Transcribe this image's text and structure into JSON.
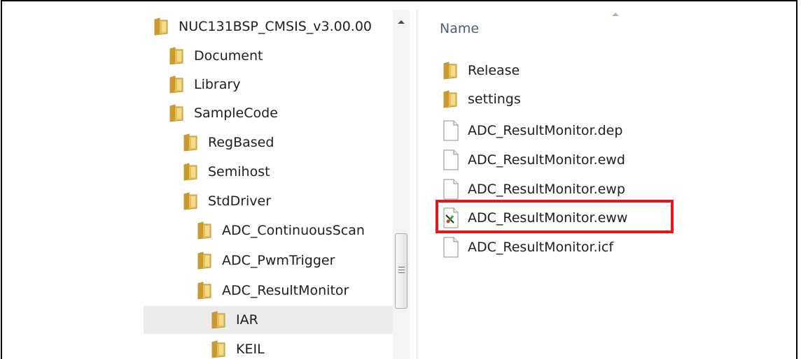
{
  "tree": {
    "items": [
      {
        "label": "NUC131BSP_CMSIS_v3.00.00",
        "name": "tree-item-nuc131bsp"
      },
      {
        "label": "Document",
        "name": "tree-item-document"
      },
      {
        "label": "Library",
        "name": "tree-item-library"
      },
      {
        "label": "SampleCode",
        "name": "tree-item-samplecode"
      },
      {
        "label": "RegBased",
        "name": "tree-item-regbased"
      },
      {
        "label": "Semihost",
        "name": "tree-item-semihost"
      },
      {
        "label": "StdDriver",
        "name": "tree-item-stddriver"
      },
      {
        "label": "ADC_ContinuousScan",
        "name": "tree-item-adc-continuousscan"
      },
      {
        "label": "ADC_PwmTrigger",
        "name": "tree-item-adc-pwmtrigger"
      },
      {
        "label": "ADC_ResultMonitor",
        "name": "tree-item-adc-resultmonitor"
      },
      {
        "label": "IAR",
        "name": "tree-item-iar"
      },
      {
        "label": "KEIL",
        "name": "tree-item-keil"
      }
    ],
    "selected": "IAR"
  },
  "filelist": {
    "column_header": "Name",
    "items": [
      {
        "label": "Release",
        "icon": "folder-icon"
      },
      {
        "label": "settings",
        "icon": "folder-icon"
      },
      {
        "label": "ADC_ResultMonitor.dep",
        "icon": "file-icon"
      },
      {
        "label": "ADC_ResultMonitor.ewd",
        "icon": "file-icon"
      },
      {
        "label": "ADC_ResultMonitor.ewp",
        "icon": "file-icon"
      },
      {
        "label": "ADC_ResultMonitor.eww",
        "icon": "iar-workspace-icon"
      },
      {
        "label": "ADC_ResultMonitor.icf",
        "icon": "file-icon"
      }
    ],
    "highlighted": "ADC_ResultMonitor.eww"
  },
  "colors": {
    "highlight": "#e8141b",
    "selection": "#ececec",
    "folder": "#e8c457"
  }
}
